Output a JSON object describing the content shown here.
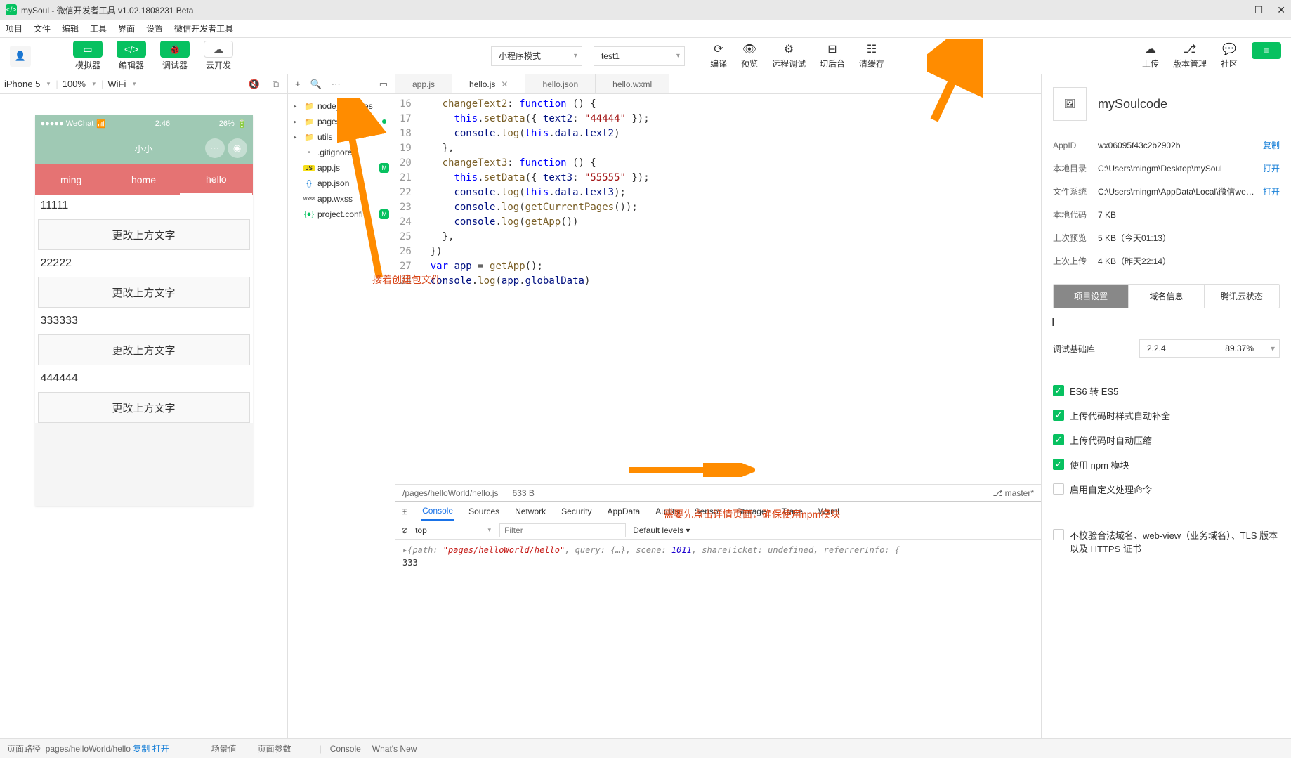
{
  "window": {
    "title": "mySoul - 微信开发者工具 v1.02.1808231 Beta"
  },
  "menubar": [
    "项目",
    "文件",
    "编辑",
    "工具",
    "界面",
    "设置",
    "微信开发者工具"
  ],
  "toolbar": {
    "simulator": "模拟器",
    "editor": "编辑器",
    "debugger": "调试器",
    "cloud": "云开发",
    "mode": "小程序模式",
    "instance": "test1",
    "compile": "编译",
    "preview": "预览",
    "remote": "远程调试",
    "background": "切后台",
    "clearCache": "清缓存",
    "upload": "上传",
    "version": "版本管理",
    "community": "社区"
  },
  "simulator": {
    "device": "iPhone 5",
    "zoom": "100%",
    "network": "WiFi",
    "statusCarrier": "●●●●● WeChat",
    "statusTime": "2:46",
    "statusBattery": "26%",
    "navTitle": "小小",
    "tabs": [
      "ming",
      "home",
      "hello"
    ],
    "activeTab": 2,
    "texts": [
      "11111",
      "22222",
      "333333",
      "444444"
    ],
    "btnLabel": "更改上方文字"
  },
  "fileTree": {
    "items": [
      {
        "name": "node_modules",
        "type": "folder",
        "expanded": true
      },
      {
        "name": "pages",
        "type": "folder",
        "expanded": true,
        "dot": true
      },
      {
        "name": "utils",
        "type": "folder",
        "expanded": true
      },
      {
        "name": ".gitignore",
        "type": "file"
      },
      {
        "name": "app.js",
        "type": "js",
        "badge": "M"
      },
      {
        "name": "app.json",
        "type": "json"
      },
      {
        "name": "app.wxss",
        "type": "wxss"
      },
      {
        "name": "project.confi",
        "type": "config",
        "badge": "M"
      }
    ]
  },
  "fileTabs": [
    {
      "name": "app.js",
      "active": false
    },
    {
      "name": "hello.js",
      "active": true,
      "closable": true
    },
    {
      "name": "hello.json",
      "active": false
    },
    {
      "name": "hello.wxml",
      "active": false
    }
  ],
  "code": {
    "startLine": 16,
    "lines": [
      {
        "n": 16,
        "html": "    <span class='fn'>changeText2</span>: <span class='kw'>function</span> () {"
      },
      {
        "n": 17,
        "html": "      <span class='this'>this</span>.<span class='fn'>setData</span>({ <span class='prop'>text2</span>: <span class='str'>\"44444\"</span> });"
      },
      {
        "n": 18,
        "html": "      <span class='prop'>console</span>.<span class='fn'>log</span>(<span class='this'>this</span>.<span class='prop'>data</span>.<span class='prop'>text2</span>)"
      },
      {
        "n": 19,
        "html": "    },"
      },
      {
        "n": 20,
        "html": "    <span class='fn'>changeText3</span>: <span class='kw'>function</span> () {"
      },
      {
        "n": 21,
        "html": "      <span class='this'>this</span>.<span class='fn'>setData</span>({ <span class='prop'>text3</span>: <span class='str'>\"55555\"</span> });"
      },
      {
        "n": 22,
        "html": "      <span class='prop'>console</span>.<span class='fn'>log</span>(<span class='this'>this</span>.<span class='prop'>data</span>.<span class='prop'>text3</span>);"
      },
      {
        "n": 23,
        "html": "      <span class='prop'>console</span>.<span class='fn'>log</span>(<span class='fn'>getCurrentPages</span>());"
      },
      {
        "n": 24,
        "html": "      <span class='prop'>console</span>.<span class='fn'>log</span>(<span class='fn'>getApp</span>())"
      },
      {
        "n": 25,
        "html": "    },"
      },
      {
        "n": 26,
        "html": "  })"
      },
      {
        "n": 27,
        "html": "  <span class='kw'>var</span> <span class='prop'>app</span> = <span class='fn'>getApp</span>();"
      },
      {
        "n": 28,
        "html": "  <span class='prop'>console</span>.<span class='fn'>log</span>(<span class='prop'>app</span>.<span class='prop'>globalData</span>)"
      }
    ],
    "path": "/pages/helloWorld/hello.js",
    "size": "633 B",
    "branch": "master*"
  },
  "devtools": {
    "tabs": [
      "Console",
      "Sources",
      "Network",
      "Security",
      "AppData",
      "Audits",
      "Sensor",
      "Storage",
      "Trace",
      "Wxml"
    ],
    "activeTab": 0,
    "context": "top",
    "filterPlaceholder": "Filter",
    "levels": "Default levels ▾",
    "consoleLines": [
      {
        "type": "obj",
        "text": "▸{path: \"pages/helloWorld/hello\", query: {…}, scene: 1011, shareTicket: undefined, referrerInfo: {"
      },
      {
        "type": "log",
        "text": "333"
      }
    ]
  },
  "details": {
    "projectName": "mySoulcode",
    "info": [
      {
        "label": "AppID",
        "value": "wx06095f43c2b2902b",
        "link": "复制"
      },
      {
        "label": "本地目录",
        "value": "C:\\Users\\mingm\\Desktop\\mySoul",
        "link": "打开"
      },
      {
        "label": "文件系统",
        "value": "C:\\Users\\mingm\\AppData\\Local\\微信we…",
        "link": "打开"
      },
      {
        "label": "本地代码",
        "value": "7 KB"
      },
      {
        "label": "上次预览",
        "value": "5 KB（今天01:13）"
      },
      {
        "label": "上次上传",
        "value": "4 KB（昨天22:14）"
      }
    ],
    "tabs": [
      "项目设置",
      "域名信息",
      "腾讯云状态"
    ],
    "activeTab": 0,
    "baseLib": {
      "label": "调试基础库",
      "value": "2.2.4",
      "pct": "89.37%"
    },
    "checks": [
      {
        "label": "ES6 转 ES5",
        "checked": true
      },
      {
        "label": "上传代码时样式自动补全",
        "checked": true
      },
      {
        "label": "上传代码时自动压缩",
        "checked": true
      },
      {
        "label": "使用 npm 模块",
        "checked": true
      },
      {
        "label": "启用自定义处理命令",
        "checked": false
      },
      {
        "label": "不校验合法域名、web-view（业务域名）、TLS 版本以及 HTTPS 证书",
        "checked": false
      }
    ]
  },
  "statusbar": {
    "pagePathLabel": "页面路径",
    "pagePath": "pages/helloWorld/hello",
    "copyLink": "复制",
    "openLink": "打开",
    "sceneValue": "场景值",
    "pageParams": "页面参数",
    "bottomTabs": [
      "Console",
      "What's New"
    ]
  },
  "annotations": {
    "createPkg": "接着创建包文件",
    "npmHint": "需要先点击详情页面，确保使用npm模块"
  }
}
